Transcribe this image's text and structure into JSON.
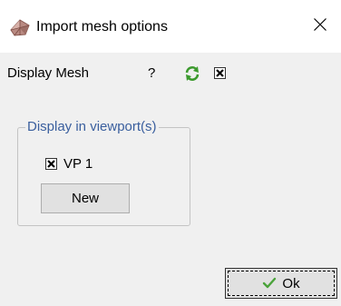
{
  "window": {
    "title": "Import mesh options",
    "icons": {
      "app": "mesh-app-icon",
      "close": "close-icon"
    }
  },
  "display_row": {
    "label": "Display Mesh",
    "help": "?",
    "refresh_icon": "refresh-icon",
    "checked": true
  },
  "viewport_group": {
    "legend": "Display in viewport(s)",
    "items": [
      {
        "label": "VP 1",
        "checked": true
      }
    ],
    "new_button_label": "New"
  },
  "ok_button": {
    "label": "Ok",
    "icon": "check-icon"
  },
  "colors": {
    "dialog_bg": "#f0f0f0",
    "titlebar_bg": "#ffffff",
    "legend_text": "#3a5f9e",
    "refresh_green": "#3c9a2e",
    "check_green": "#4aa33a"
  }
}
